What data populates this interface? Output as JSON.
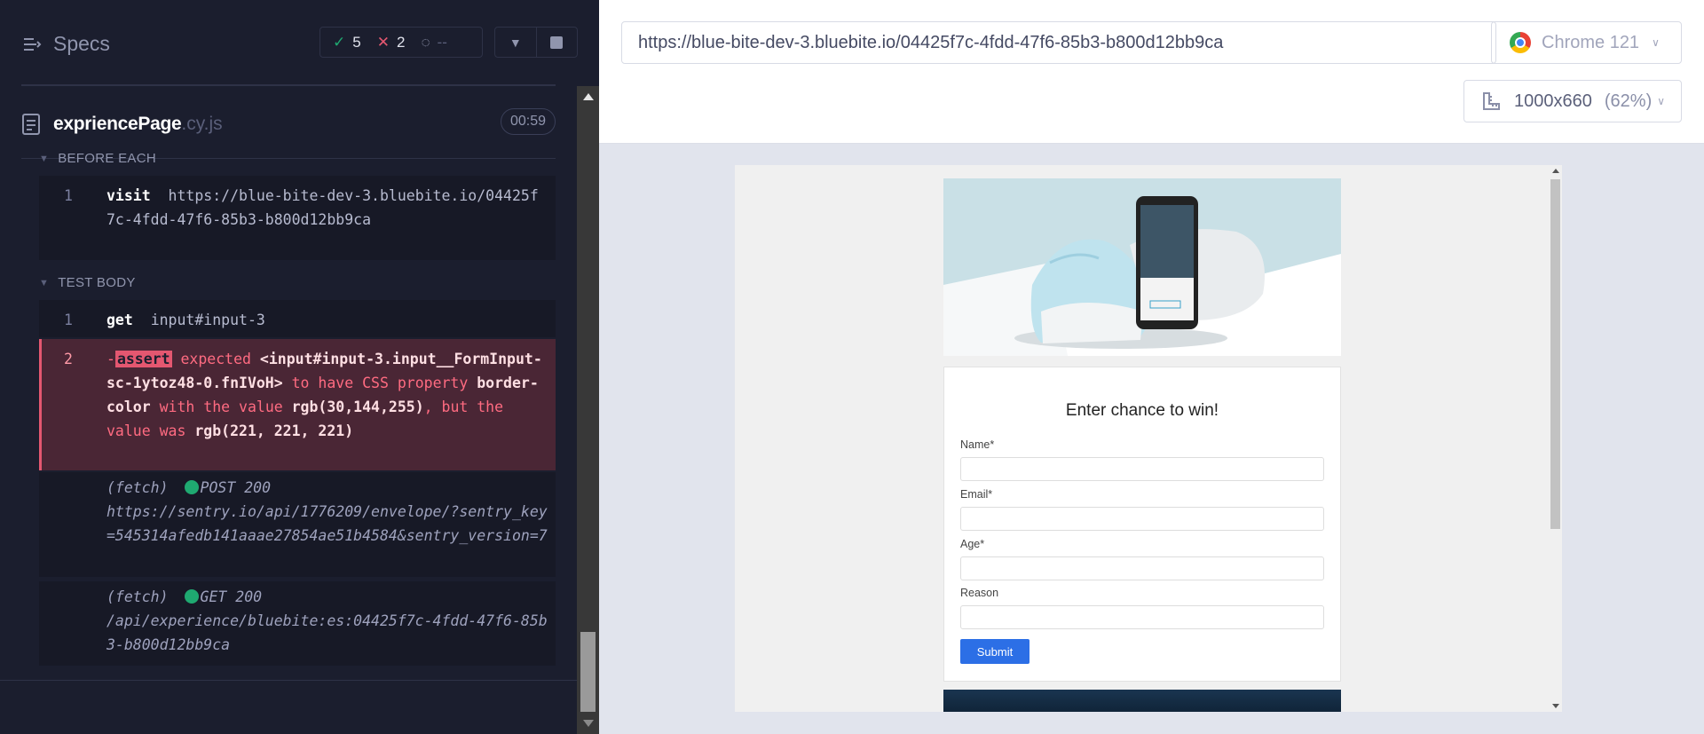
{
  "reporter": {
    "specs_label": "Specs",
    "stats": {
      "passed": "5",
      "failed": "2",
      "pending": "--"
    },
    "file": {
      "name": "expriencePage",
      "ext": ".cy.js",
      "duration": "00:59"
    },
    "before_each": {
      "label": "BEFORE EACH",
      "commands": [
        {
          "index": "1",
          "name": "visit",
          "message": "https://blue-bite-dev-3.bluebite.io/04425f7c-4fdd-47f6-85b3-b800d12bb9ca"
        }
      ]
    },
    "test_body": {
      "label": "TEST BODY",
      "commands": [
        {
          "index": "1",
          "name": "get",
          "message": "input#input-3"
        }
      ],
      "failed_assert": {
        "index": "2",
        "prefix": "-",
        "name": "assert",
        "expected_word": "expected",
        "subject": "<input#input-3.input__FormInput-sc-1ytoz48-0.fnIVoH>",
        "to_have": "to have CSS property",
        "property": "border-color",
        "with_value": "with the value",
        "expected_value": "rgb(30,144,255)",
        "but_was": ", but the value was",
        "actual_value": "rgb(221, 221, 221)"
      },
      "fetches": [
        {
          "type": "(fetch)",
          "method_status": "POST 200",
          "url": "https://sentry.io/api/1776209/envelope/?sentry_key=545314afedb141aaae27854ae51b4584&sentry_version=7"
        },
        {
          "type": "(fetch)",
          "method_status": "GET 200",
          "url": "/api/experience/bluebite:es:04425f7c-4fdd-47f6-85b3-b800d12bb9ca"
        }
      ]
    }
  },
  "preview": {
    "url": "https://blue-bite-dev-3.bluebite.io/04425f7c-4fdd-47f6-85b3-b800d12bb9ca",
    "browser": "Chrome 121",
    "viewport": "1000x660",
    "zoom": "(62%)",
    "form": {
      "title": "Enter chance to win!",
      "fields": [
        {
          "label": "Name*"
        },
        {
          "label": "Email*"
        },
        {
          "label": "Age*"
        },
        {
          "label": "Reason"
        }
      ],
      "submit": "Submit"
    }
  },
  "colors": {
    "pass": "#1fa971",
    "fail": "#e45770",
    "submit": "#2c6fe6"
  }
}
